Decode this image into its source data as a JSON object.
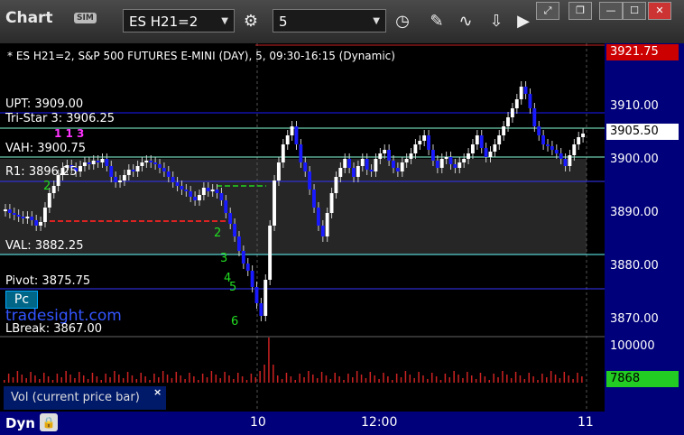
{
  "titlebar": {
    "logo": "Chart",
    "sim_badge": "SIM",
    "symbol": "ES H21=2",
    "interval": "5"
  },
  "header": {
    "description": "* ES H21=2, S&P 500 FUTURES E-MINI (DAY), 5, 09:30-16:15 (Dynamic)"
  },
  "levels": {
    "upt": "UPT: 3909.00",
    "tristar": "Tri-Star 3: 3906.25",
    "vah": "VAH: 3900.75",
    "r1": "R1: 3896.25",
    "val": "VAL: 3882.25",
    "pivot": "Pivot: 3875.75",
    "lbreak": "LBreak: 3867.00"
  },
  "price_axis": {
    "top_highlight": "3921.75",
    "current": "3905.50",
    "ticks": [
      "3910.00",
      "3900.00",
      "3890.00",
      "3880.00",
      "3870.00"
    ],
    "vol_high": "100000",
    "vol_current": "7868"
  },
  "overlays": {
    "pc_label": "Pc",
    "watermark": "tradesight.com"
  },
  "volume_panel": {
    "legend": "Vol (current price bar)",
    "close": "×"
  },
  "bottom": {
    "dyn": "Dyn",
    "times": [
      "10",
      "12:00",
      "11"
    ]
  },
  "colors": {
    "axis_bg": "#00007a",
    "current_price_bg": "#ffffff",
    "top_price_bg": "#cc0000",
    "vol_current_bg": "#22cc22",
    "bull_candle": "#ffffff",
    "bear_candle": "#1a1aff"
  }
}
